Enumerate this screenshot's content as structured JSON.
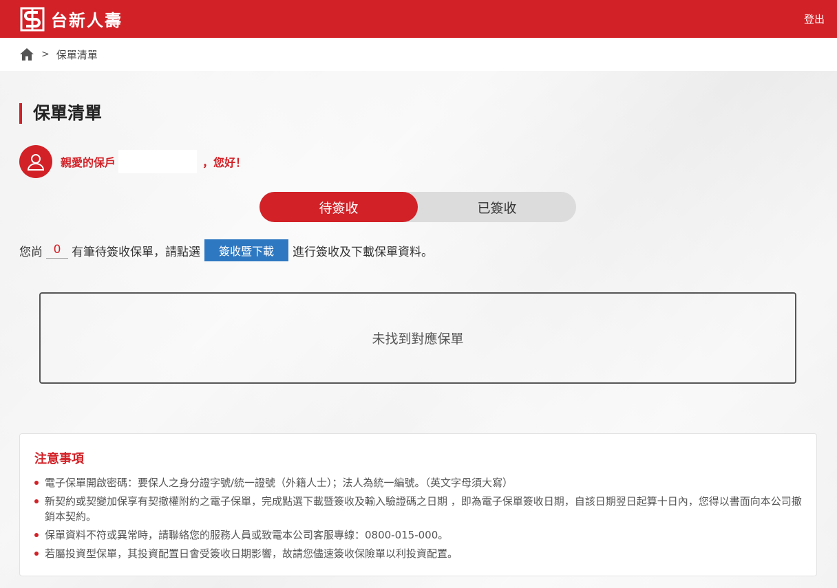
{
  "header": {
    "brand_name": "台新人壽",
    "logout_label": "登出",
    "brand_color": "#d22127"
  },
  "breadcrumb": {
    "separator": ">",
    "current": "保單清單"
  },
  "page": {
    "title": "保單清單"
  },
  "greeting": {
    "prefix": "親愛的保戶",
    "suffix": "，您好！"
  },
  "tabs": [
    {
      "label": "待簽收",
      "active": true
    },
    {
      "label": "已簽收",
      "active": false
    }
  ],
  "instruction": {
    "before_count": "您尚",
    "count": "0",
    "after_count": "有筆待簽收保單，請點選",
    "button_label": "簽收暨下載",
    "after_button": "進行簽收及下載保單資料。"
  },
  "empty_message": "未找到對應保單",
  "notice": {
    "title": "注意事項",
    "items": [
      "電子保單開啟密碼：要保人之身分證字號/統一證號（外籍人士）；法人為統一編號。（英文字母須大寫）",
      "新契約或契變加保享有契撤權附約之電子保單，完成點選下載暨簽收及輸入驗證碼之日期 ，即為電子保單簽收日期，自該日期翌日起算十日內，您得以書面向本公司撤銷本契約。",
      "保單資料不符或異常時，請聯絡您的服務人員或致電本公司客服專線：0800-015-000。",
      "若屬投資型保單，其投資配置日會受簽收日期影響，故請您儘速簽收保險單以利投資配置。"
    ]
  },
  "icons": {
    "brand": "taishin-logo-icon",
    "home": "home-icon",
    "avatar": "user-icon"
  }
}
